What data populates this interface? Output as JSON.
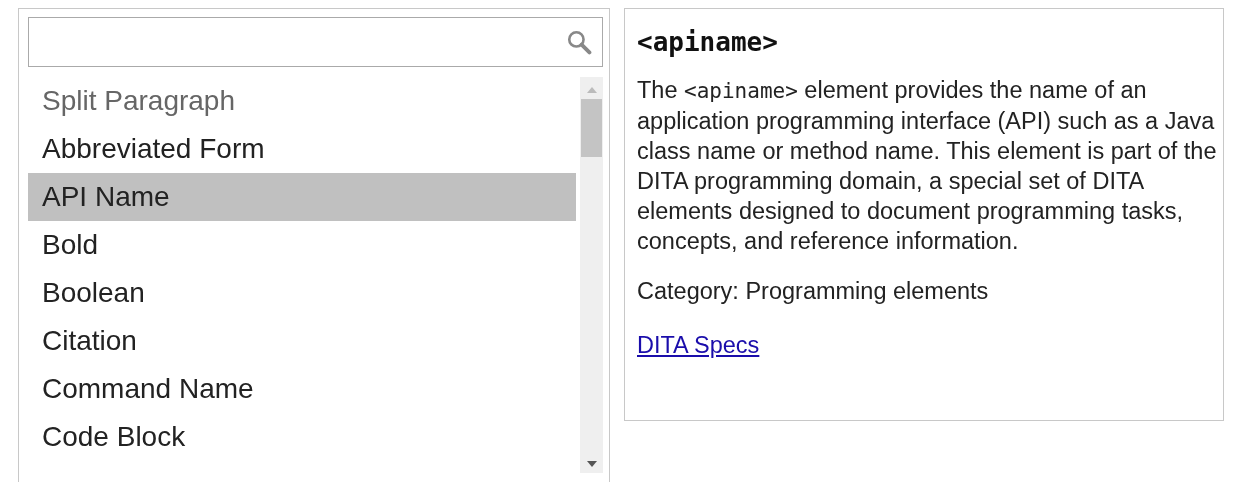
{
  "elements": [
    {
      "label": "Split Paragraph",
      "disabled": true,
      "selected": false
    },
    {
      "label": "Abbreviated Form",
      "disabled": false,
      "selected": false
    },
    {
      "label": "API Name",
      "disabled": false,
      "selected": true
    },
    {
      "label": "Bold",
      "disabled": false,
      "selected": false
    },
    {
      "label": "Boolean",
      "disabled": false,
      "selected": false
    },
    {
      "label": "Citation",
      "disabled": false,
      "selected": false
    },
    {
      "label": "Command Name",
      "disabled": false,
      "selected": false
    },
    {
      "label": "Code Block",
      "disabled": false,
      "selected": false
    }
  ],
  "details": {
    "heading": "<apiname>",
    "description": [
      {
        "kind": "text",
        "text": "The "
      },
      {
        "kind": "code",
        "text": "<apiname>"
      },
      {
        "kind": "text",
        "text": " element provides the name of an application programming interface (API) such as a Java class name or method name. This element is part of the DITA programming domain, a special set of DITA elements designed to document programming tasks, concepts, and reference information."
      }
    ],
    "category": "Category: Programming elements",
    "link": "DITA Specs"
  }
}
